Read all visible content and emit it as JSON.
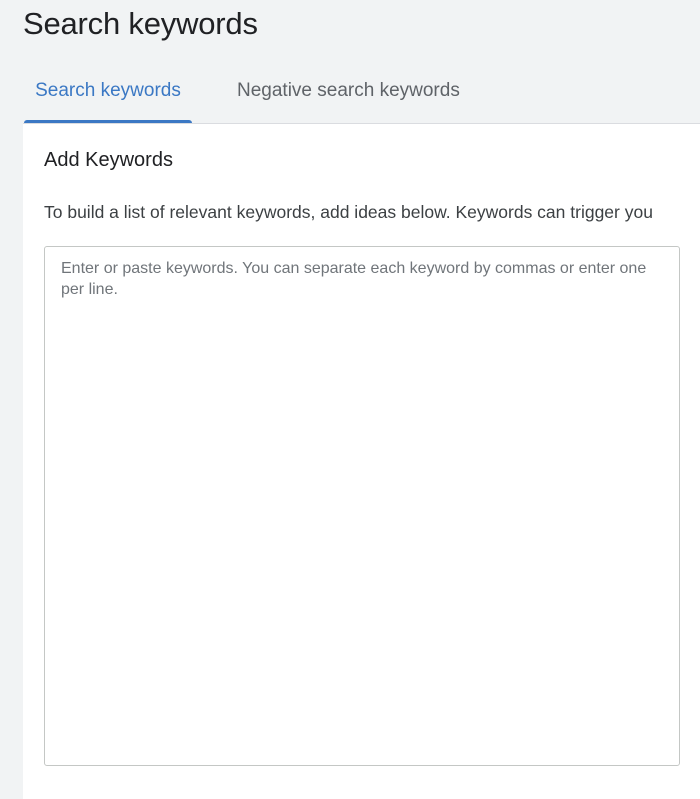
{
  "header": {
    "title": "Search keywords"
  },
  "tabs": [
    {
      "label": "Search keywords",
      "selected": true
    },
    {
      "label": "Negative search keywords",
      "selected": false
    }
  ],
  "main": {
    "section_title": "Add Keywords",
    "description": "To build a list of relevant keywords, add ideas below. Keywords can trigger you",
    "keywords_input": {
      "value": "",
      "placeholder": "Enter or paste keywords. You can separate each keyword by commas or enter one per line."
    }
  },
  "colors": {
    "accent": "#3b78c4",
    "page_background": "#f1f3f4",
    "card_background": "#ffffff"
  }
}
